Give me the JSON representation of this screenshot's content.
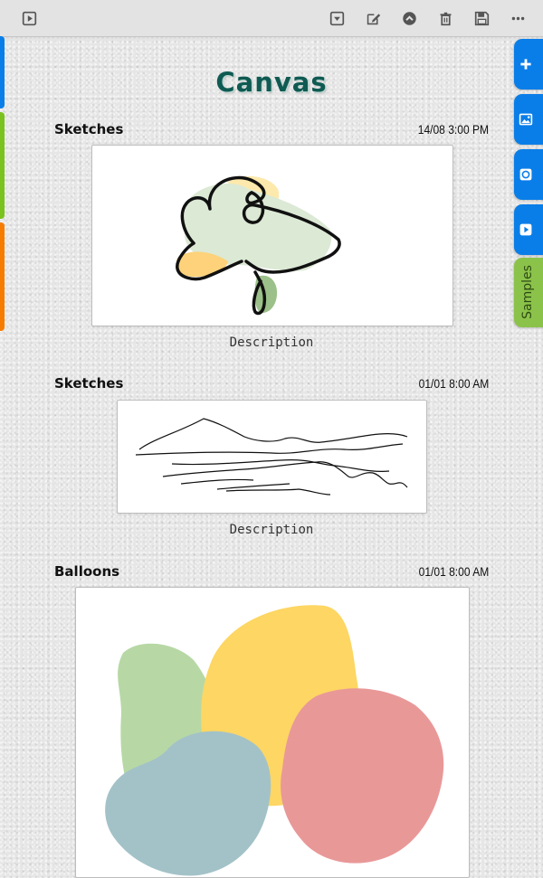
{
  "page": {
    "title": "Canvas"
  },
  "toolbar": {
    "icons": [
      "play-box-icon",
      "dropdown-box-icon",
      "edit-icon",
      "chevron-up-circle-icon",
      "trash-icon",
      "save-icon",
      "more-icon"
    ]
  },
  "right_tabs": {
    "icons": [
      "plus-icon",
      "image-icon",
      "circle-icon",
      "play-box-icon"
    ],
    "samples_label": "Samples"
  },
  "entries": [
    {
      "label": "Sketches",
      "date": "14/08 3:00 PM",
      "description": "Description"
    },
    {
      "label": "Sketches",
      "date": "01/01 8:00 AM",
      "description": "Description"
    },
    {
      "label": "Balloons",
      "date": "01/01 8:00 AM"
    }
  ],
  "colors": {
    "title": "#0f5a52",
    "tab_blue": "#0a7ee8",
    "tab_green": "#8bc34a",
    "strip_blue": "#0a7ee8",
    "strip_green": "#7cc21e",
    "strip_orange": "#f57c00",
    "balloon_green": "#b7d8a5",
    "balloon_yellow": "#fdd663",
    "balloon_blue": "#a3c2c8",
    "balloon_red": "#e99898"
  }
}
